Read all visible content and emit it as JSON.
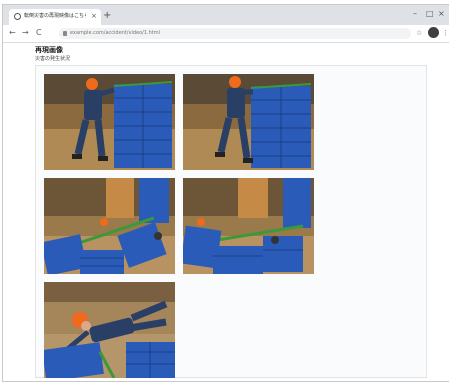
{
  "browser": {
    "tab_title": "転倒災害の再現映像はこちら",
    "tab_close": "×",
    "new_tab": "+",
    "window_controls": [
      "–",
      "□",
      "×"
    ],
    "nav": {
      "back": "←",
      "forward": "→",
      "reload": "C"
    },
    "url": "example.com/accident/video/1.html",
    "toolbar_icons": [
      "☆",
      "⋮"
    ],
    "avatar_initial": "👤"
  },
  "page": {
    "title": "再現画像",
    "subtitle": "災害の発生状況"
  },
  "gallery": {
    "photos": [
      {
        "name": "worker-pushing-crates-1"
      },
      {
        "name": "worker-pushing-crates-2"
      },
      {
        "name": "cart-tipping-over-1"
      },
      {
        "name": "cart-tipping-over-2"
      },
      {
        "name": "worker-lying-fallen"
      }
    ]
  }
}
